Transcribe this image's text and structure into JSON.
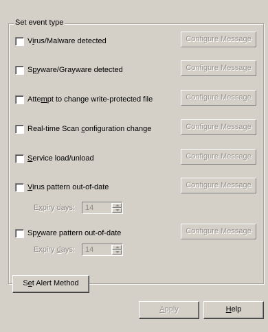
{
  "group": {
    "legend": "Set event type"
  },
  "events": [
    {
      "pre": "V",
      "acc": "i",
      "post": "rus/Malware detected",
      "checked": false,
      "configure": "Configure Message"
    },
    {
      "pre": "S",
      "acc": "p",
      "post": "yware/Grayware detected",
      "checked": false,
      "configure": "Configure Message"
    },
    {
      "pre": "Atte",
      "acc": "m",
      "post": "pt to change write-protected file",
      "checked": false,
      "configure": "Configure Message"
    },
    {
      "pre": "Real-time Scan ",
      "acc": "c",
      "post": "onfiguration change",
      "checked": false,
      "configure": "Configure Message"
    },
    {
      "pre": "",
      "acc": "S",
      "post": "ervice load/unload",
      "checked": false,
      "configure": "Configure Message"
    },
    {
      "pre": "",
      "acc": "V",
      "post": "irus pattern out-of-date",
      "checked": false,
      "configure": "Configure Message"
    },
    {
      "pre": "Sp",
      "acc": "y",
      "post": "ware pattern out-of-date",
      "checked": false,
      "configure": "Configure Message"
    }
  ],
  "virus_expiry": {
    "pre": "E",
    "acc": "x",
    "post": "piry days:",
    "value": "14"
  },
  "spyware_expiry": {
    "pre": "Expiry ",
    "acc": "d",
    "post": "ays:",
    "value": "14"
  },
  "alert_button": {
    "pre": "S",
    "acc": "e",
    "post": "t Alert Method"
  },
  "apply_button": {
    "pre": "",
    "acc": "A",
    "post": "pply"
  },
  "help_button": {
    "pre": "",
    "acc": "H",
    "post": "elp"
  }
}
